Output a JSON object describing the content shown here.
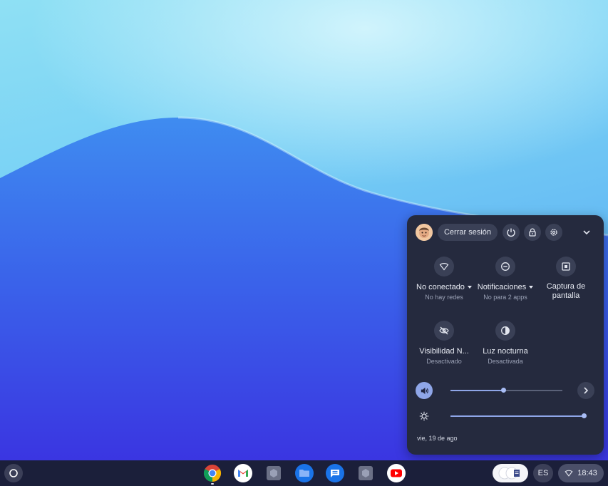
{
  "quick_settings": {
    "sign_out_label": "Cerrar sesión",
    "tiles": [
      {
        "label": "No conectado",
        "sublabel": "No hay redes",
        "icon": "wifi-icon",
        "has_dropdown": true
      },
      {
        "label": "Notificaciones",
        "sublabel": "No para 2 apps",
        "icon": "do-not-disturb-icon",
        "has_dropdown": true
      },
      {
        "label": "Captura de pantalla",
        "sublabel": "",
        "icon": "screen-capture-icon",
        "has_dropdown": false
      },
      {
        "label": "Visibilidad N...",
        "sublabel": "Desactivado",
        "icon": "visibility-off-icon",
        "has_dropdown": false
      },
      {
        "label": "Luz nocturna",
        "sublabel": "Desactivada",
        "icon": "night-light-icon",
        "has_dropdown": false
      }
    ],
    "volume_level": 0.47,
    "brightness_level": 1.0,
    "date": "vie, 19 de ago"
  },
  "shelf": {
    "apps": [
      "chrome-icon",
      "gmail-icon",
      "app-placeholder-icon",
      "files-icon",
      "messages-icon",
      "app-placeholder-icon",
      "youtube-icon"
    ],
    "language": "ES",
    "time": "18:43"
  },
  "colors": {
    "panel_bg": "#252a3e",
    "accent": "#8fa6e8",
    "shelf_bg": "#1b1f3a"
  }
}
